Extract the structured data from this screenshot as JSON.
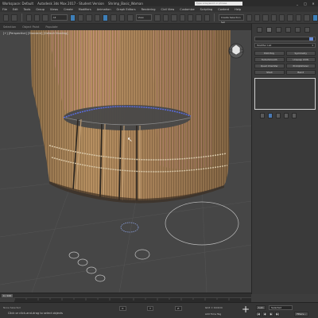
{
  "titlebar": {
    "app_title": "Workspace: Default",
    "file_title": "Autodesk 3ds Max 2017 - Student Version",
    "project_name": "Shrimp_Basic_Woman",
    "search_placeholder": "Type a keyword or phrase",
    "buttons": [
      "_",
      "□",
      "✕"
    ]
  },
  "menubar": {
    "items": [
      "File",
      "Edit",
      "Tools",
      "Group",
      "Views",
      "Create",
      "Modifiers",
      "Animation",
      "Graph Editors",
      "Rendering",
      "Civil View",
      "Customize",
      "Scripting",
      "Content",
      "Help"
    ]
  },
  "toolbar": {
    "selection_filter": "All",
    "view_dropdown": "View",
    "named_set": "Create Selection Set"
  },
  "ribbon": {
    "tabs": [
      "Selection",
      "Object Paint",
      "Populate"
    ]
  },
  "viewport": {
    "label": "[+] [Perspective] [Standard] [Default Shading]"
  },
  "command_panel": {
    "object_name": "",
    "modifier_list_label": "Modifier List",
    "buttons": [
      {
        "label": "Edit Poly"
      },
      {
        "label": "Symmetry"
      },
      {
        "label": "TurboSmooth"
      },
      {
        "label": "Unwrap UVW"
      },
      {
        "label": "Quad Chamfer"
      },
      {
        "label": "ProOptimizer"
      },
      {
        "label": "Shell"
      },
      {
        "label": "Bend"
      }
    ]
  },
  "timeline": {
    "frame_indicator": "0 / 100"
  },
  "statusbar": {
    "selection_info": "None Selected",
    "prompt": "Click or click-and-drag to select objects",
    "x_label": "X:",
    "y_label": "Y:",
    "z_label": "Z:",
    "grid": "Grid = 10.0cm",
    "add_time_tag": "Add Time Tag",
    "auto_label": "Auto",
    "set_key_filter": "Selected",
    "filters_label": "Filters...",
    "play_buttons": [
      "|◀",
      "◀",
      "▶",
      "▶|"
    ]
  },
  "colors": {
    "accent": "#3d7fb8",
    "viewport_bg": "#464646",
    "hair_tone": "#a8845a",
    "skin_tone": "#c77a86",
    "edge_highlight": "#5a6de0"
  }
}
